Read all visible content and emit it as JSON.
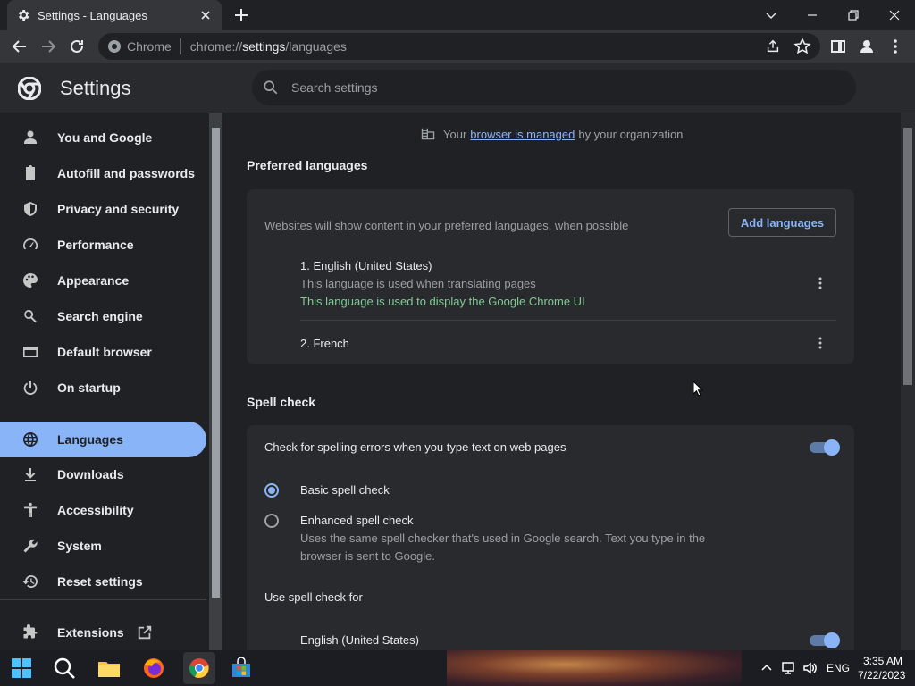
{
  "tab": {
    "title": "Settings - Languages"
  },
  "omnibox": {
    "site": "Chrome",
    "url_prefix": "chrome://",
    "url_host": "settings",
    "url_path": "/languages"
  },
  "settings": {
    "title": "Settings",
    "search_placeholder": "Search settings"
  },
  "sidebar": {
    "items": [
      {
        "label": "You and Google"
      },
      {
        "label": "Autofill and passwords"
      },
      {
        "label": "Privacy and security"
      },
      {
        "label": "Performance"
      },
      {
        "label": "Appearance"
      },
      {
        "label": "Search engine"
      },
      {
        "label": "Default browser"
      },
      {
        "label": "On startup"
      },
      {
        "label": "Languages"
      },
      {
        "label": "Downloads"
      },
      {
        "label": "Accessibility"
      },
      {
        "label": "System"
      },
      {
        "label": "Reset settings"
      },
      {
        "label": "Extensions"
      }
    ],
    "active": "Languages"
  },
  "managed": {
    "prefix": "Your",
    "link": "browser is managed",
    "suffix": "by your organization"
  },
  "preferred": {
    "title": "Preferred languages",
    "description": "Websites will show content in your preferred languages, when possible",
    "add_button": "Add languages",
    "languages": [
      {
        "name": "1. English (United States)",
        "note1": "This language is used when translating pages",
        "note2": "This language is used to display the Google Chrome UI"
      },
      {
        "name": "2. French"
      }
    ]
  },
  "spell": {
    "title": "Spell check",
    "check_label": "Check for spelling errors when you type text on web pages",
    "check_on": true,
    "basic_label": "Basic spell check",
    "enhanced_label": "Enhanced spell check",
    "enhanced_desc1": "Uses the same spell checker that's used in Google search. Text you type in the",
    "enhanced_desc2": "browser is sent to Google.",
    "selected": "basic",
    "use_for": "Use spell check for",
    "use_for_langs": [
      {
        "name": "English (United States)",
        "on": true
      }
    ]
  },
  "taskbar": {
    "lang": "ENG",
    "time": "3:35 AM",
    "date": "7/22/2023"
  },
  "colors": {
    "accent": "#8ab4f8",
    "green": "#81c995",
    "bg": "#202124",
    "card": "#292a2d"
  }
}
